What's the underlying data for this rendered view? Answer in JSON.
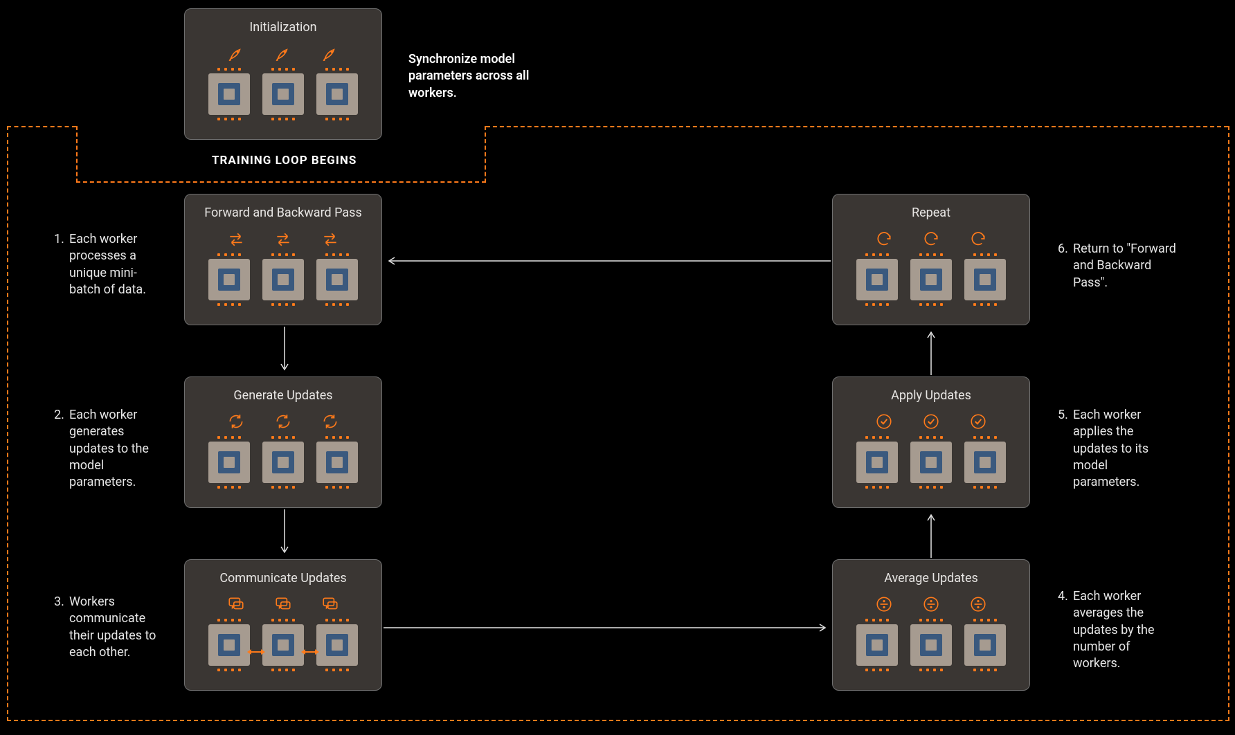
{
  "initialization": {
    "title": "Initialization",
    "description": "Synchronize model parameters across all workers."
  },
  "loop_label": "TRAINING LOOP BEGINS",
  "nodes": {
    "forward": {
      "title": "Forward and Backward Pass"
    },
    "generate": {
      "title": "Generate Updates"
    },
    "communicate": {
      "title": "Communicate Updates"
    },
    "average": {
      "title": "Average Updates"
    },
    "apply": {
      "title": "Apply Updates"
    },
    "repeat": {
      "title": "Repeat"
    }
  },
  "steps": {
    "s1": {
      "num": "1.",
      "text": "Each worker processes a unique mini-batch of data."
    },
    "s2": {
      "num": "2.",
      "text": "Each worker generates updates to the model parameters."
    },
    "s3": {
      "num": "3.",
      "text": "Workers communicate their updates to each other."
    },
    "s4": {
      "num": "4.",
      "text": "Each worker averages the updates by the number of workers."
    },
    "s5": {
      "num": "5.",
      "text": "Each worker applies the updates to its model parameters."
    },
    "s6": {
      "num": "6.",
      "text": "Return to \"Forward and Backward Pass\"."
    }
  },
  "colors": {
    "accent": "#ff7a1a",
    "bg_dark": "#000000",
    "bg_loop": "#16253a"
  }
}
